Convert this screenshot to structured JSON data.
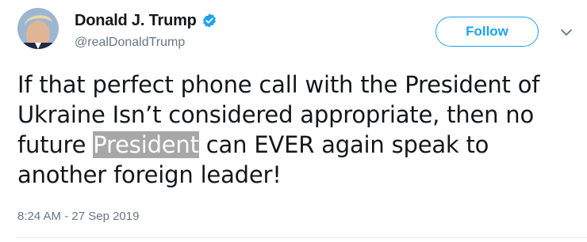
{
  "author": {
    "display_name": "Donald J. Trump",
    "handle": "@realDonaldTrump",
    "verified": true,
    "avatar_icon": "profile-photo"
  },
  "actions": {
    "follow_label": "Follow",
    "menu_icon": "chevron-down-icon"
  },
  "tweet": {
    "line1": "If that perfect phone call with the President of",
    "line2": "Ukraine Isn’t considered appropriate, then no",
    "line3_before": "future ",
    "line3_highlight": "President",
    "line3_after": " can EVER again speak to",
    "line4": "another foreign leader!"
  },
  "meta": {
    "timestamp": "8:24 AM - 27 Sep 2019"
  },
  "colors": {
    "accent": "#1da1f2",
    "text": "#14171a",
    "muted": "#657786",
    "highlight": "#a7a7a7"
  }
}
